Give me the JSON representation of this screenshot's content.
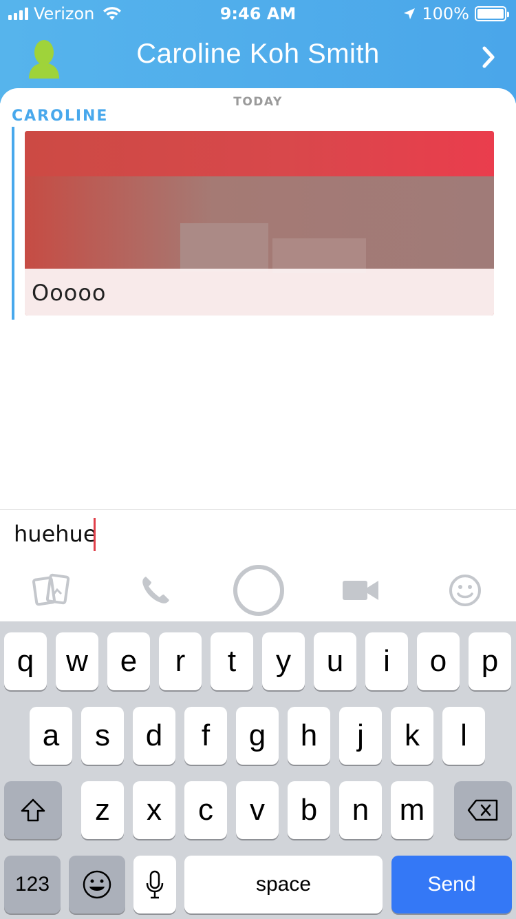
{
  "status_bar": {
    "carrier": "Verizon",
    "time": "9:46 AM",
    "battery": "100%",
    "signal_bars": 4
  },
  "header": {
    "contact_name": "Caroline Koh Smith"
  },
  "chat": {
    "date_label": "TODAY",
    "sender": "CAROLINE",
    "message_caption": "Ooooo"
  },
  "composer": {
    "text": "huehue"
  },
  "actions": [
    "memories-icon",
    "phone-icon",
    "camera-shutter-button",
    "video-icon",
    "emoji-icon"
  ],
  "keyboard": {
    "row1": [
      "q",
      "w",
      "e",
      "r",
      "t",
      "y",
      "u",
      "i",
      "o",
      "p"
    ],
    "row2": [
      "a",
      "s",
      "d",
      "f",
      "g",
      "h",
      "j",
      "k",
      "l"
    ],
    "row3": [
      "z",
      "x",
      "c",
      "v",
      "b",
      "n",
      "m"
    ],
    "numbers_label": "123",
    "space_label": "space",
    "send_label": "Send"
  },
  "colors": {
    "header_blue": "#4aa6ea",
    "accent_blue": "#48a8ec",
    "send_blue": "#3478f6",
    "cursor_red": "#e0404a",
    "avatar_green": "#9fd33a"
  }
}
